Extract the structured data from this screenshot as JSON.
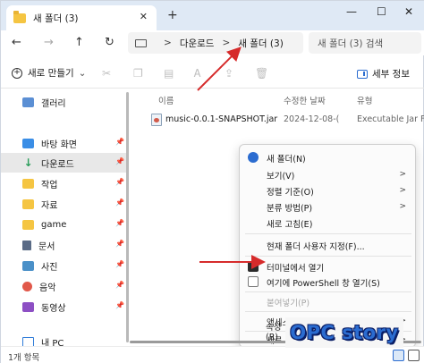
{
  "window": {
    "tab_title": "새 폴더 (3)",
    "tab_close": "✕",
    "tab_add": "+",
    "minimize": "—",
    "maximize": "☐",
    "close": "✕"
  },
  "nav": {
    "back": "←",
    "forward": "→",
    "up": "↑",
    "refresh": "↻",
    "path_separator": ">",
    "breadcrumb": [
      "다운로드",
      "새 폴더 (3)"
    ],
    "search_placeholder": "새 폴더 (3) 검색"
  },
  "toolbar": {
    "new_label": "새로 만들기",
    "new_dropdown": "⌄",
    "icons": [
      "cut-icon",
      "copy-icon",
      "paste-icon",
      "rename-icon",
      "share-icon",
      "delete-icon"
    ],
    "detail_label": "세부 정보"
  },
  "sidebar": {
    "items": [
      {
        "label": "갤러리",
        "icon": "gallery-icon",
        "pinned": false
      },
      {
        "label": "바탕 화면",
        "icon": "desktop-icon",
        "pinned": true
      },
      {
        "label": "다운로드",
        "icon": "download-icon",
        "pinned": true,
        "active": true
      },
      {
        "label": "작업",
        "icon": "folder-icon",
        "pinned": true
      },
      {
        "label": "자료",
        "icon": "folder-icon",
        "pinned": true
      },
      {
        "label": "game",
        "icon": "folder-icon",
        "pinned": true
      },
      {
        "label": "문서",
        "icon": "document-icon",
        "pinned": true
      },
      {
        "label": "사진",
        "icon": "pictures-icon",
        "pinned": true
      },
      {
        "label": "음악",
        "icon": "music-icon",
        "pinned": true
      },
      {
        "label": "동영상",
        "icon": "video-icon",
        "pinned": true
      },
      {
        "label": "내 PC",
        "icon": "pc-icon",
        "pinned": false
      }
    ],
    "pin_glyph": "📌"
  },
  "columns": {
    "name": "이름",
    "modified": "수정한 날짜",
    "type": "유형"
  },
  "files": [
    {
      "name": "music-0.0.1-SNAPSHOT.jar",
      "modified": "2024-12-08-(",
      "type": "Executable Jar File"
    }
  ],
  "status": {
    "count": "1개 항목"
  },
  "context_menu": {
    "items": [
      {
        "label": "새 폴더(N)",
        "icon": "new-folder-icon",
        "chevron": false,
        "disabled": false
      },
      {
        "label": "보기(V)",
        "chevron": true,
        "disabled": false
      },
      {
        "label": "정렬 기준(O)",
        "chevron": true,
        "disabled": false
      },
      {
        "label": "분류 방법(P)",
        "chevron": true,
        "disabled": false
      },
      {
        "label": "새로 고침(E)",
        "chevron": false,
        "disabled": false
      },
      {
        "label": "현재 폴더 사용자 지정(F)...",
        "chevron": false,
        "disabled": false
      },
      {
        "label": "터미널에서 열기",
        "icon": "terminal-icon",
        "chevron": false,
        "disabled": false
      },
      {
        "label": "여기에 PowerShell 창 열기(S)",
        "icon": "powershell-icon",
        "chevron": false,
        "disabled": false
      },
      {
        "label": "붙여넣기(P)",
        "chevron": false,
        "disabled": true
      },
      {
        "label": "액세스 권한 부여 (G)",
        "chevron": true,
        "disabled": false
      },
      {
        "label": "새로 만들기(W)",
        "chevron": true,
        "disabled": false
      },
      {
        "label": "속성(R)",
        "chevron": false,
        "disabled": false
      }
    ],
    "chevron_glyph": ">"
  },
  "watermark": {
    "text": "OPC story"
  },
  "colors": {
    "accent": "#2b6cd0",
    "arrow": "#d62b2b",
    "tabbar": "#dfe9f5"
  }
}
